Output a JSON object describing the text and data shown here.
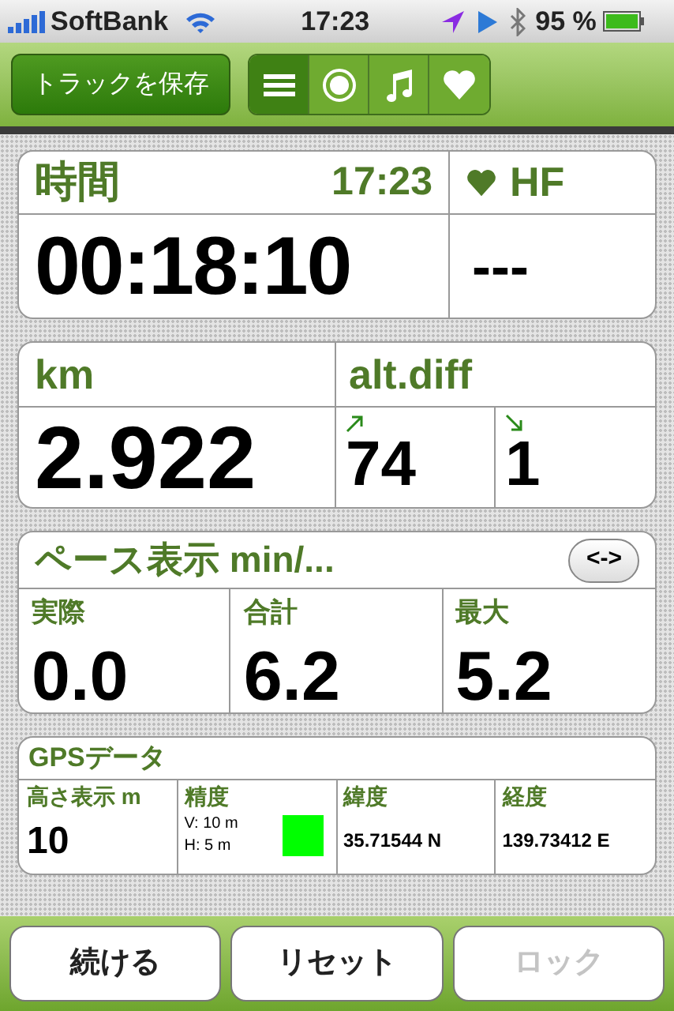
{
  "status_bar": {
    "carrier": "SoftBank",
    "time": "17:23",
    "battery": "95 %"
  },
  "toolbar": {
    "save_button": "トラックを保存",
    "tabs": [
      {
        "kind": "list",
        "selected": true
      },
      {
        "kind": "record",
        "selected": false
      },
      {
        "kind": "music",
        "selected": false
      },
      {
        "kind": "heart",
        "selected": false
      }
    ]
  },
  "time_panel": {
    "label": "時間",
    "clock": "17:23",
    "value": "00:18:10",
    "hr_label": "HF",
    "hr_value": "---"
  },
  "distance_panel": {
    "label": "km",
    "value": "2.922",
    "alt_label": "alt.diff",
    "alt_values": [
      {
        "kind": "up",
        "value": "74"
      },
      {
        "kind": "down",
        "value": "1"
      }
    ]
  },
  "pace_panel": {
    "label": "ペース表示 min/...",
    "toggle": "<->",
    "columns": [
      {
        "label": "実際",
        "value": "0.0"
      },
      {
        "label": "合計",
        "value": "6.2"
      },
      {
        "label": "最大",
        "value": "5.2"
      }
    ]
  },
  "gps_panel": {
    "label": "GPSデータ",
    "altitude": {
      "label": "高さ表示 m",
      "value": "10"
    },
    "accuracy": {
      "label": "精度",
      "vertical": "V: 10 m",
      "horizontal": "H: 5 m",
      "color": "#00ff00"
    },
    "latitude": {
      "label": "緯度",
      "value": "35.71544 N"
    },
    "longitude": {
      "label": "経度",
      "value": "139.73412 E"
    }
  },
  "buttons": [
    {
      "label": "続ける",
      "disabled": false
    },
    {
      "label": "リセット",
      "disabled": false
    },
    {
      "label": "ロック",
      "disabled": true
    }
  ]
}
